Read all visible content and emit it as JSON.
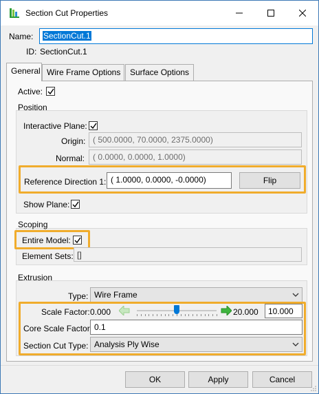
{
  "window": {
    "title": "Section Cut Properties",
    "controls": {
      "minimize": "minimize-icon",
      "maximize": "maximize-icon",
      "close": "close-icon"
    }
  },
  "header": {
    "name_label": "Name:",
    "name_value": "SectionCut.1",
    "id_label": "ID:",
    "id_value": "SectionCut.1"
  },
  "tabs": [
    {
      "label": "General",
      "active": true
    },
    {
      "label": "Wire Frame Options",
      "active": false
    },
    {
      "label": "Surface Options",
      "active": false
    }
  ],
  "general": {
    "active_label": "Active:",
    "active_checked": true,
    "position": {
      "title": "Position",
      "interactive_plane_label": "Interactive Plane:",
      "interactive_plane_checked": true,
      "origin_label": "Origin:",
      "origin_value": "( 500.0000, 70.0000, 2375.0000)",
      "normal_label": "Normal:",
      "normal_value": "( 0.0000, 0.0000, 1.0000)",
      "ref_dir_label": "Reference Direction 1:",
      "ref_dir_value": "( 1.0000, 0.0000, -0.0000)",
      "flip_label": "Flip",
      "show_plane_label": "Show Plane:",
      "show_plane_checked": true
    },
    "scoping": {
      "title": "Scoping",
      "entire_model_label": "Entire Model:",
      "entire_model_checked": true,
      "element_sets_label": "Element Sets:",
      "element_sets_value": "[]"
    },
    "extrusion": {
      "title": "Extrusion",
      "type_label": "Type:",
      "type_value": "Wire Frame",
      "scale_factor_label": "Scale Factor:",
      "slider_min": "0.000",
      "slider_max": "20.000",
      "scale_factor_value": "10.000",
      "slider_fraction": 0.5,
      "core_scale_label": "Core Scale Factor:",
      "core_scale_value": "0.1",
      "section_cut_type_label": "Section Cut Type:",
      "section_cut_type_value": "Analysis Ply Wise"
    }
  },
  "footer": {
    "ok": "OK",
    "apply": "Apply",
    "cancel": "Cancel"
  },
  "colors": {
    "highlight": "#f0ac2c",
    "selection": "#0078d7",
    "arrow": "#3fb53f"
  }
}
